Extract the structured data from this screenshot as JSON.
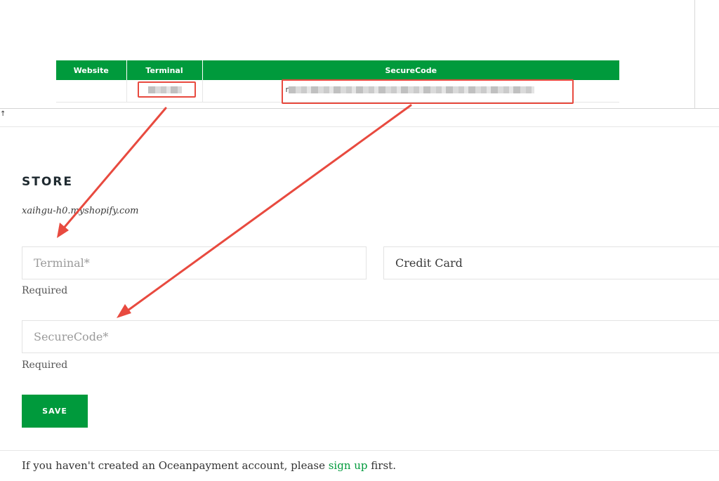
{
  "credentials_table": {
    "headers": [
      "Website",
      "Terminal",
      "SecureCode"
    ],
    "row": {
      "website": "",
      "terminal": "",
      "securecode": "r"
    }
  },
  "strip_mark": "↑",
  "store": {
    "heading": "STORE",
    "domain": "xaihgu-h0.myshopify.com"
  },
  "form": {
    "terminal_placeholder": "Terminal*",
    "payment_method_value": "Credit Card",
    "securecode_placeholder": "SecureCode*",
    "required_label": "Required",
    "save_label": "SAVE"
  },
  "footer": {
    "text_before": "If you haven't created an Oceanpayment account, please ",
    "link_text": "sign up",
    "text_after": " first."
  },
  "colors": {
    "brand_green": "#009a3c",
    "annotation_red": "#e84a3f"
  }
}
